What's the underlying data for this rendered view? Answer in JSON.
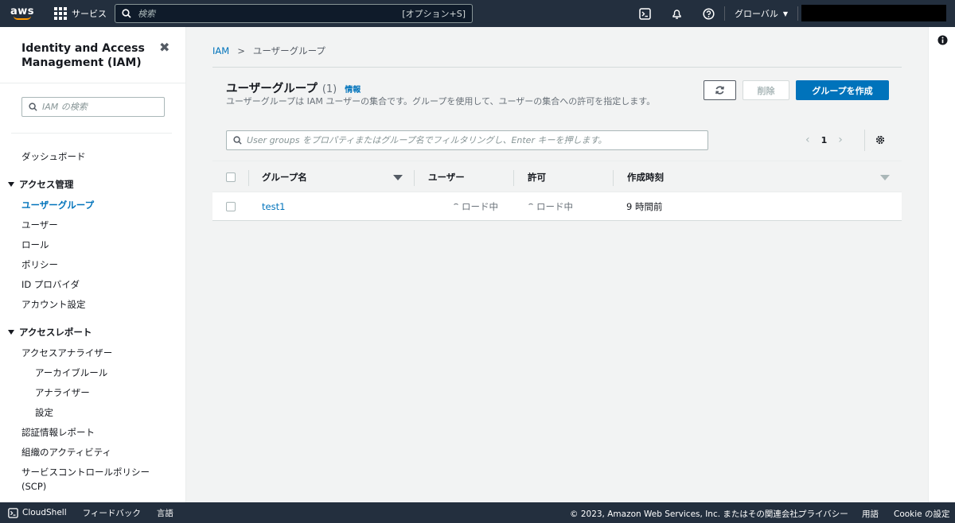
{
  "topnav": {
    "logo_text": "aws",
    "services_label": "サービス",
    "search_placeholder": "検索",
    "search_shortcut": "[オプション+S]",
    "region_label": "グローバル"
  },
  "sidenav": {
    "title": "Identity and Access Management (IAM)",
    "search_placeholder": "IAM の検索",
    "dashboard": "ダッシュボード",
    "section_access_mgmt": "アクセス管理",
    "items_access": [
      "ユーザーグループ",
      "ユーザー",
      "ロール",
      "ポリシー",
      "ID プロバイダ",
      "アカウント設定"
    ],
    "section_access_reports": "アクセスレポート",
    "analyzer": "アクセスアナライザー",
    "analyzer_sub": [
      "アーカイブルール",
      "アナライザー",
      "設定"
    ],
    "items_reports": [
      "認証情報レポート",
      "組織のアクティビティ",
      "サービスコントロールポリシー",
      "(SCP)"
    ]
  },
  "breadcrumb": {
    "root": "IAM",
    "current": "ユーザーグループ"
  },
  "panel": {
    "title": "ユーザーグループ",
    "count": "(1)",
    "info_link": "情報",
    "description": "ユーザーグループは IAM ユーザーの集合です。グループを使用して、ユーザーの集合への許可を指定します。",
    "delete_label": "削除",
    "create_label": "グループを作成",
    "filter_placeholder": "User groups をプロパティまたはグループ名でフィルタリングし、Enter キーを押します。",
    "page_number": "1"
  },
  "table": {
    "columns": [
      "グループ名",
      "ユーザー",
      "許可",
      "作成時刻"
    ],
    "rows": [
      {
        "group_name": "test1",
        "users": "ロード中",
        "permissions": "ロード中",
        "created": "9 時間前"
      }
    ]
  },
  "footer": {
    "cloudshell": "CloudShell",
    "feedback": "フィードバック",
    "language": "言語",
    "copyright": "© 2023, Amazon Web Services, Inc. またはその関連会社。",
    "privacy": "プライバシー",
    "terms": "用語",
    "cookie": "Cookie の設定"
  },
  "colors": {
    "nav_bg": "#232f3e",
    "link": "#0073bb",
    "primary_button": "#0073bb",
    "accent_orange": "#ff9900"
  }
}
